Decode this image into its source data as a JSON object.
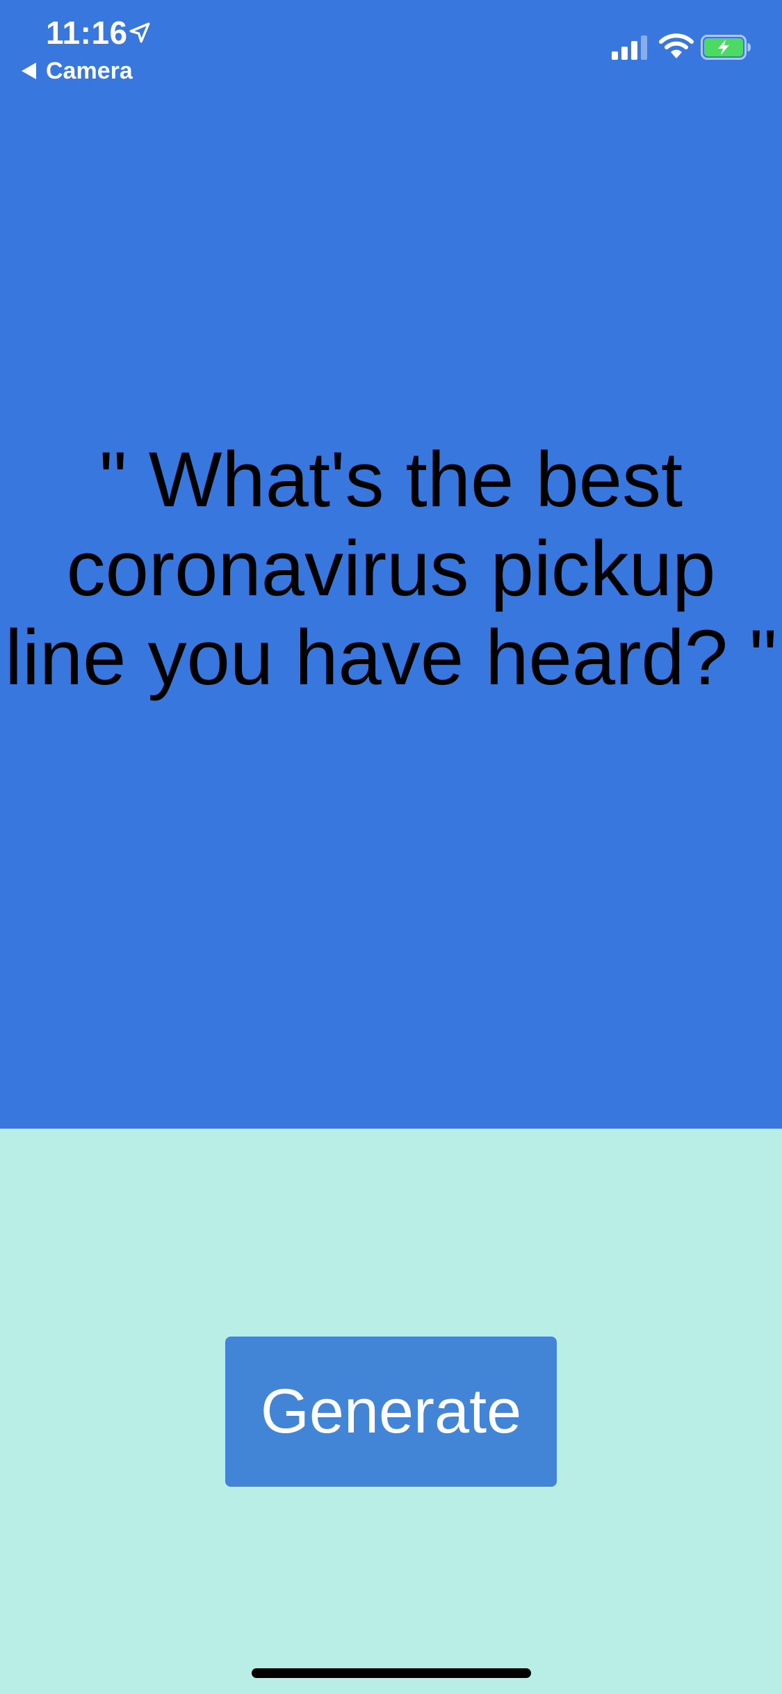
{
  "status_bar": {
    "time": "11:16",
    "back_label": "Camera",
    "icons": [
      "location-arrow-icon",
      "back-arrow-icon",
      "signal-icon",
      "wifi-icon",
      "battery-charging-icon"
    ]
  },
  "quote": {
    "text": "\" What's the best\ncoronavirus pickup\nline you have heard? \""
  },
  "actions": {
    "generate_label": "Generate"
  },
  "colors": {
    "top_background": "#3877DE",
    "bottom_background": "#B9EEE7",
    "button_background": "#4284D6",
    "button_text": "#FFFFFF",
    "quote_text": "#000000",
    "battery_fill": "#4CD964"
  }
}
